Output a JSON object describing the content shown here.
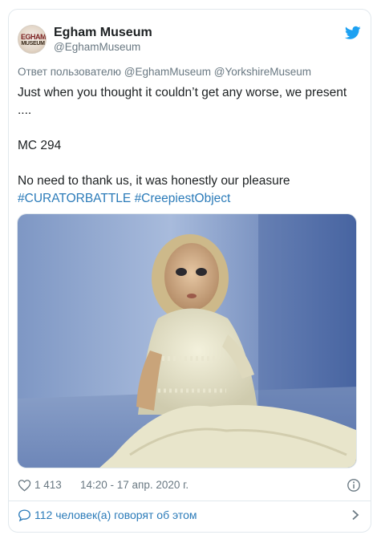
{
  "author": {
    "display_name": "Egham Museum",
    "handle": "@EghamMuseum",
    "avatar_text_line1": "EGHAM",
    "avatar_text_line2": "MUSEUM"
  },
  "reply_context": "Ответ пользователю @EghamMuseum @YorkshireMuseum",
  "tweet": {
    "line1": "Just when you thought it couldn’t get any worse, we present ....",
    "line2": "MC 294",
    "line3": "No need to thank us, it was honestly our pleasure",
    "hashtag1": "#CURATORBATTLE",
    "hashtag2": "#CreepiestObject"
  },
  "media": {
    "description_icon": "doll-photo"
  },
  "meta": {
    "likes": "1 413",
    "timestamp": "14:20 - 17 апр. 2020 г."
  },
  "conversation": {
    "label": "112 человек(а) говорят об этом"
  },
  "colors": {
    "link": "#2b7bb9",
    "muted": "#697882",
    "twitter_blue": "#1da1f2",
    "border": "#e1e8ed"
  }
}
